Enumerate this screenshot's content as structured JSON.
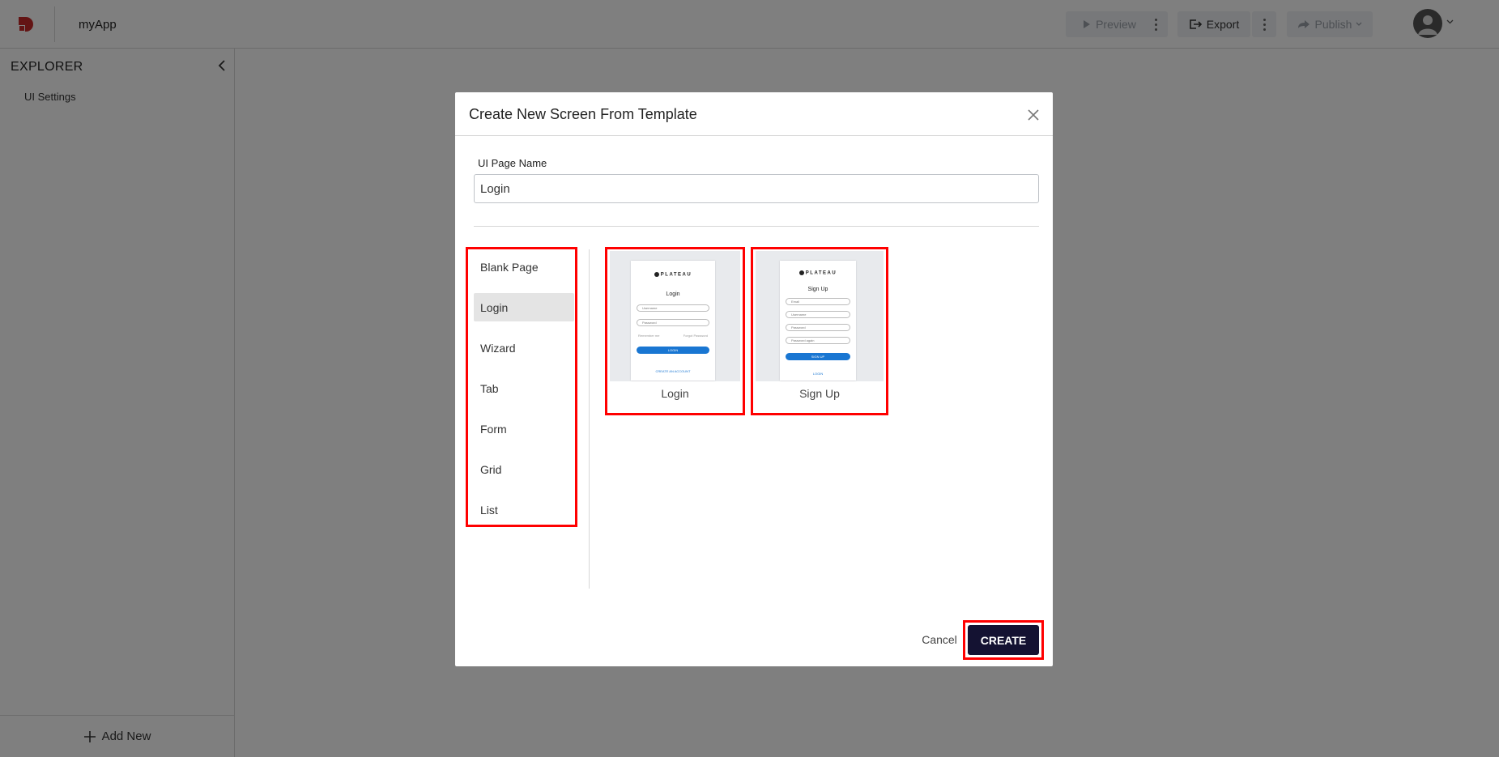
{
  "app": {
    "name": "myApp"
  },
  "toolbar": {
    "preview_label": "Preview",
    "export_label": "Export",
    "publish_label": "Publish"
  },
  "sidebar": {
    "title": "EXPLORER",
    "items": [
      {
        "label": "UI Settings"
      }
    ],
    "add_new_label": "Add New"
  },
  "modal": {
    "title": "Create New Screen From Template",
    "field_label": "UI Page Name",
    "field_value": "Login",
    "categories": [
      {
        "label": "Blank Page"
      },
      {
        "label": "Login"
      },
      {
        "label": "Wizard"
      },
      {
        "label": "Tab"
      },
      {
        "label": "Form"
      },
      {
        "label": "Grid"
      },
      {
        "label": "List"
      }
    ],
    "selected_category": "Login",
    "templates": [
      {
        "caption": "Login",
        "brand": "PLATEAU",
        "heading": "Login",
        "fields": [
          "Username",
          "Password"
        ],
        "remember": "Remember me",
        "forgot": "Forgot Password",
        "button": "LOGIN",
        "link": "CREATE AN ACCOUNT"
      },
      {
        "caption": "Sign Up",
        "brand": "PLATEAU",
        "heading": "Sign Up",
        "fields": [
          "Email",
          "Username",
          "Password",
          "Password again"
        ],
        "button": "SIGN UP",
        "link": "LOGIN"
      }
    ],
    "cancel_label": "Cancel",
    "create_label": "CREATE"
  },
  "colors": {
    "highlight": "#ff0000",
    "primary_button": "#141232",
    "overlay": "rgba(0,0,0,0.5)",
    "brand_logo": "#c62828",
    "mini_button": "#1976d2"
  }
}
